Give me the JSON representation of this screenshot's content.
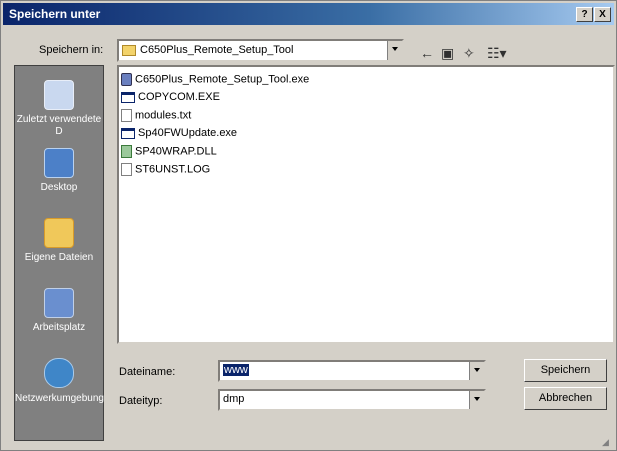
{
  "window": {
    "title": "Speichern unter",
    "help_label": "?",
    "close_label": "X"
  },
  "save_in": {
    "label": "Speichern in:",
    "value": "C650Plus_Remote_Setup_Tool"
  },
  "places": [
    {
      "label": "Zuletzt verwendete D",
      "icon": "recent-documents-icon"
    },
    {
      "label": "Desktop",
      "icon": "desktop-icon"
    },
    {
      "label": "Eigene Dateien",
      "icon": "my-documents-icon"
    },
    {
      "label": "Arbeitsplatz",
      "icon": "my-computer-icon"
    },
    {
      "label": "Netzwerkumgebung",
      "icon": "network-icon"
    }
  ],
  "files": [
    {
      "name": "C650Plus_Remote_Setup_Tool.exe",
      "icon": "app-exe-icon"
    },
    {
      "name": "COPYCOM.EXE",
      "icon": "exe-window-icon"
    },
    {
      "name": "modules.txt",
      "icon": "text-file-icon"
    },
    {
      "name": "Sp40FWUpdate.exe",
      "icon": "exe-window-icon"
    },
    {
      "name": "SP40WRAP.DLL",
      "icon": "dll-icon"
    },
    {
      "name": "ST6UNST.LOG",
      "icon": "log-file-icon"
    }
  ],
  "filename": {
    "label": "Dateiname:",
    "value": "www"
  },
  "filetype": {
    "label": "Dateityp:",
    "value": "dmp"
  },
  "buttons": {
    "save": "Speichern",
    "cancel": "Abbrechen"
  },
  "toolbar": {
    "back_icon": "back-arrow-icon",
    "up_icon": "folder-up-icon",
    "new_folder_icon": "new-folder-icon",
    "views_icon": "views-menu-icon"
  }
}
